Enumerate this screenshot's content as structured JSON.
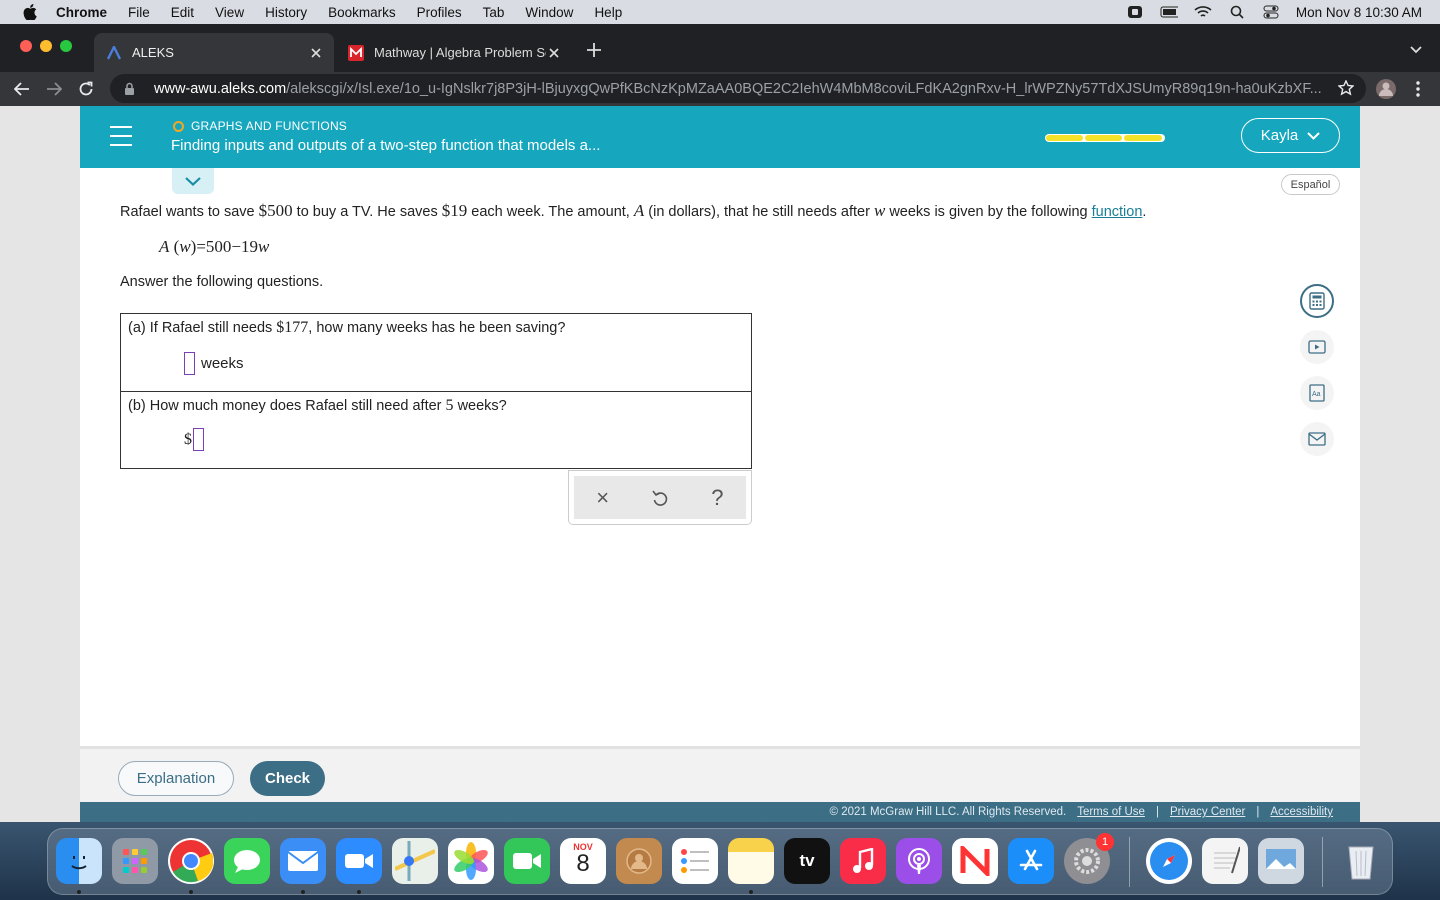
{
  "menubar": {
    "app_name": "Chrome",
    "items": [
      "File",
      "Edit",
      "View",
      "History",
      "Bookmarks",
      "Profiles",
      "Tab",
      "Window",
      "Help"
    ],
    "clock": "Mon Nov 8  10:30 AM"
  },
  "tabs": [
    {
      "title": "ALEKS",
      "active": true
    },
    {
      "title": "Mathway | Algebra Problem Sol",
      "active": false
    }
  ],
  "address_bar": {
    "host": "www-awu.aleks.com",
    "path": "/alekscgi/x/Isl.exe/1o_u-IgNslkr7j8P3jH-lBjuyxgQwPfKBcNzKpMZaAA0BQE2C2IehW4MbM8coviLFdKA2gnRxv-H_lrWPZNy57TdXJSUmyR89q19n-ha0uKzbXF..."
  },
  "header": {
    "topic": "GRAPHS AND FUNCTIONS",
    "title": "Finding inputs and outputs of a two-step function that models a...",
    "user_name": "Kayla",
    "progress_segments": 3,
    "accent": "#16a7bf"
  },
  "language_button": "Español",
  "problem": {
    "p1": "Rafael wants to save ",
    "goal": "$500",
    "p2": " to buy a TV. He saves ",
    "weekly": "$19",
    "p3": " each week. The amount, ",
    "var_a": "A",
    "p4": " (in dollars), that he still needs after ",
    "var_w": "w",
    "p5": " weeks is given by the following ",
    "link": "function",
    "p6": "."
  },
  "equation": {
    "lhs_func": "A",
    "lhs_arg": "w",
    "rhs_const": "500",
    "rhs_coef": "19",
    "rhs_var": "w"
  },
  "instruction": "Answer the following questions.",
  "questions": {
    "a": {
      "text_before": "(a) If Rafael still needs ",
      "amount": "$177",
      "text_after": ", how many weeks has he been saving?",
      "unit": "weeks",
      "value": ""
    },
    "b": {
      "text_before": "(b) How much money does Rafael still need after ",
      "number": "5",
      "text_after": " weeks?",
      "prefix": "$",
      "value": ""
    }
  },
  "toolpad": {
    "clear": "×",
    "undo_icon": "undo-icon",
    "help": "?"
  },
  "side_tools": [
    "calculator-icon",
    "video-icon",
    "dictionary-icon",
    "mail-icon"
  ],
  "footer": {
    "explanation": "Explanation",
    "check": "Check",
    "copyright": "© 2021 McGraw Hill LLC. All Rights Reserved.",
    "terms": "Terms of Use",
    "privacy": "Privacy Center",
    "accessibility": "Accessibility",
    "separator": "|"
  },
  "dock": {
    "calendar_month": "NOV",
    "calendar_day": "8",
    "tv_label": "tv",
    "settings_badge": "1"
  }
}
